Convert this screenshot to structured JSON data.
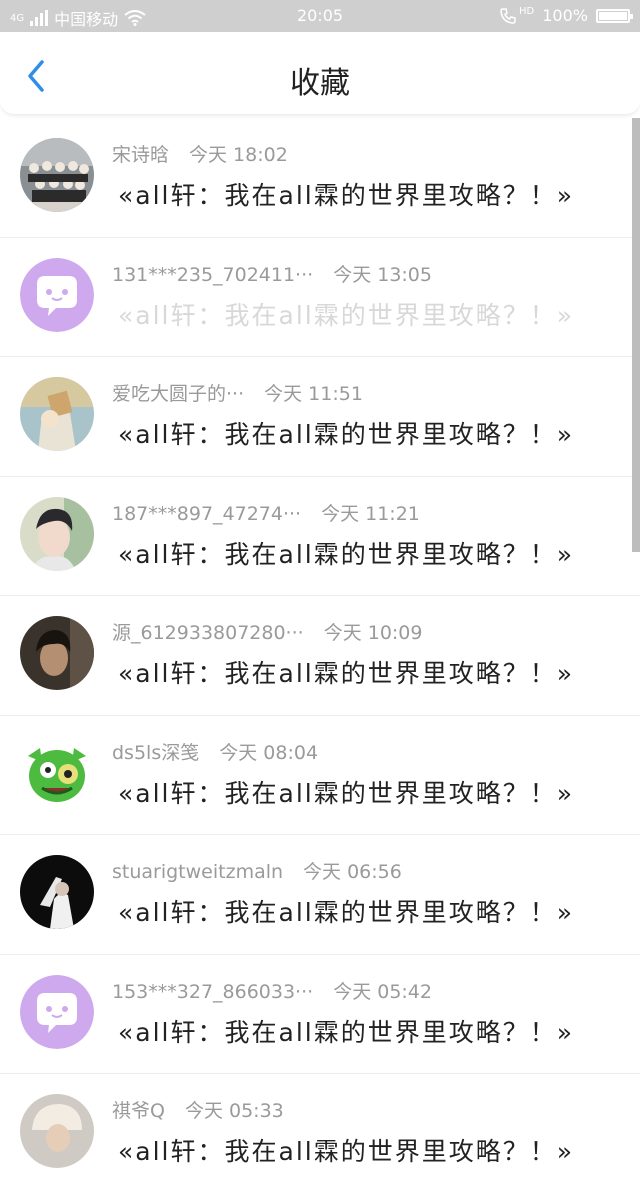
{
  "status_bar": {
    "carrier": "中国移动",
    "network": "4G",
    "time": "20:05",
    "hd": "HD",
    "battery": "100%"
  },
  "header": {
    "title": "收藏",
    "back_icon": "chevron-left-icon"
  },
  "colors": {
    "accent": "#2f8fe8",
    "meta_gray": "#9a9a9a",
    "avatar_purple": "#cfa9ee"
  },
  "items": [
    {
      "author": "宋诗晗",
      "time": "今天 18:02",
      "content": "«all轩：我在all霖的世界里攻略？！»",
      "arrow": "»",
      "avatar": "group-photo"
    },
    {
      "author": "131***235_702411···",
      "time": "今天 13:05",
      "content": "«all轩：我在all霖的世界里攻略？！»",
      "arrow": "»",
      "avatar": "default-chat-bubble"
    },
    {
      "author": "爱吃大圆子的···",
      "time": "今天 11:51",
      "content": "«all轩：我在all霖的世界里攻略？！»",
      "arrow": "»",
      "avatar": "photo"
    },
    {
      "author": "187***897_47274···",
      "time": "今天 11:21",
      "content": "«all轩：我在all霖的世界里攻略？！»",
      "arrow": "»",
      "avatar": "photo"
    },
    {
      "author": "源_612933807280···",
      "time": "今天 10:09",
      "content": "«all轩：我在all霖的世界里攻略？！»",
      "arrow": "»",
      "avatar": "photo"
    },
    {
      "author": "ds5ls深笺",
      "time": "今天 08:04",
      "content": "«all轩：我在all霖的世界里攻略？！»",
      "arrow": "»",
      "avatar": "green-cartoon"
    },
    {
      "author": "stuarigtweitzmaln",
      "time": "今天 06:56",
      "content": "«all轩：我在all霖的世界里攻略？！»",
      "arrow": "»",
      "avatar": "photo-dark"
    },
    {
      "author": "153***327_866033···",
      "time": "今天 05:42",
      "content": "«all轩：我在all霖的世界里攻略？！»",
      "arrow": "»",
      "avatar": "default-chat-bubble"
    },
    {
      "author": "祺爷Q",
      "time": "今天 05:33",
      "content": "«all轩：我在all霖的世界里攻略？！»",
      "arrow": "»",
      "avatar": "photo"
    }
  ]
}
